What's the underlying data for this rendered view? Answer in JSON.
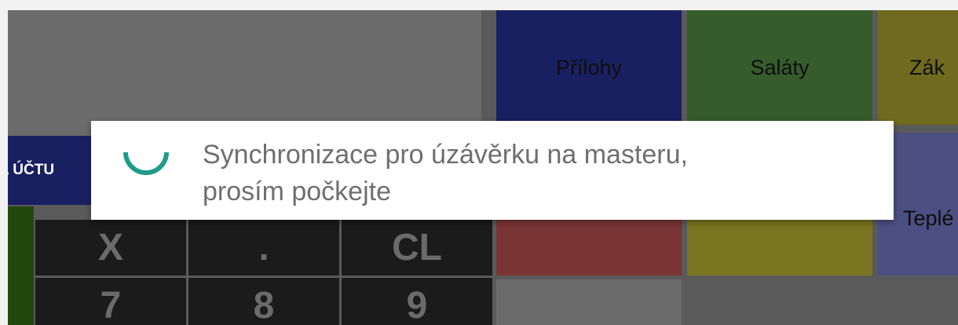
{
  "pos": {
    "account_button_label": "A ÚČTU",
    "keypad": {
      "row1": [
        "X",
        ".",
        "CL"
      ],
      "row2": [
        "7",
        "8",
        "9"
      ]
    },
    "categories": [
      {
        "label": "Přílohy",
        "color": "#192062"
      },
      {
        "label": "Saláty",
        "color": "#365c2b"
      },
      {
        "label": "Zák",
        "color": "#6f6a1e"
      },
      {
        "label": "Teplé",
        "color": "#4b4f82"
      }
    ],
    "category_tiles_partial_colors": [
      "#7a3434",
      "#7a7520",
      "#4b4f82"
    ]
  },
  "dialog": {
    "message_line1": "Synchronizace pro úzávěrku na masteru,",
    "message_line2": "prosím počkejte",
    "spinner_color": "#1e9c8a"
  }
}
